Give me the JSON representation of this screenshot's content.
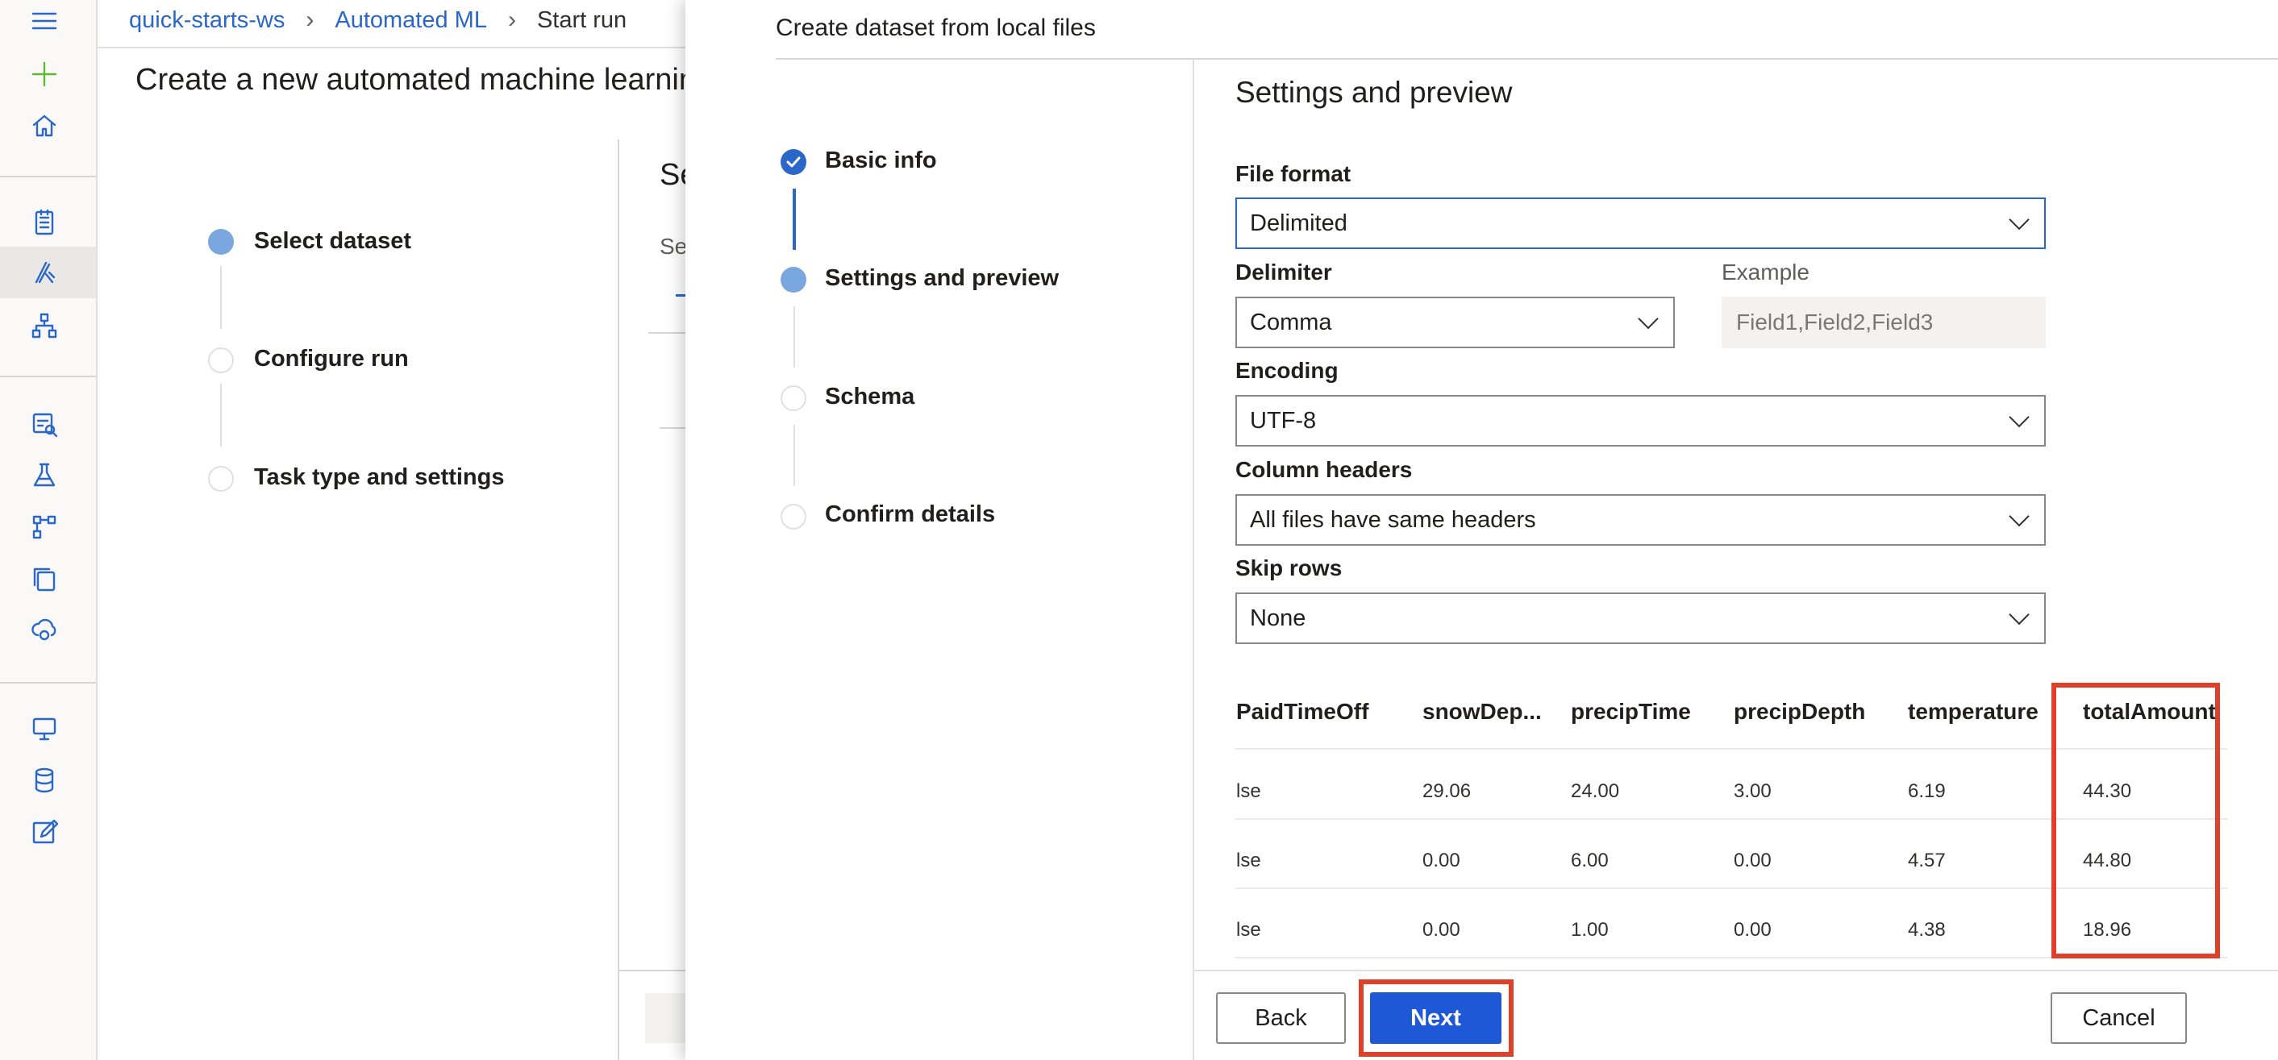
{
  "breadcrumb": {
    "workspace": "quick-starts-ws",
    "section": "Automated ML",
    "current": "Start run"
  },
  "background": {
    "page_title": "Create a new automated machine learning",
    "steps": [
      "Select dataset",
      "Configure run",
      "Task type and settings"
    ],
    "stub_title": "Se",
    "stub_sub": "Se"
  },
  "panel": {
    "title": "Create dataset from local files",
    "wizard_steps": [
      "Basic info",
      "Settings and preview",
      "Schema",
      "Confirm details"
    ],
    "section_title": "Settings and preview",
    "fields": {
      "file_format": {
        "label": "File format",
        "value": "Delimited"
      },
      "delimiter": {
        "label": "Delimiter",
        "value": "Comma"
      },
      "example": {
        "label": "Example",
        "value": "Field1,Field2,Field3"
      },
      "encoding": {
        "label": "Encoding",
        "value": "UTF-8"
      },
      "column_headers": {
        "label": "Column headers",
        "value": "All files have same headers"
      },
      "skip_rows": {
        "label": "Skip rows",
        "value": "None"
      }
    },
    "preview_table": {
      "columns": [
        "PaidTimeOff",
        "snowDep...",
        "precipTime",
        "precipDepth",
        "temperature",
        "totalAmount"
      ],
      "rows": [
        [
          "lse",
          "29.06",
          "24.00",
          "3.00",
          "6.19",
          "44.30"
        ],
        [
          "lse",
          "0.00",
          "6.00",
          "0.00",
          "4.57",
          "44.80"
        ],
        [
          "lse",
          "0.00",
          "1.00",
          "0.00",
          "4.38",
          "18.96"
        ]
      ]
    },
    "buttons": {
      "back": "Back",
      "next": "Next",
      "cancel": "Cancel"
    }
  },
  "colors": {
    "accent": "#2b67c9",
    "primary_button": "#1f58d6",
    "highlight": "#e0402a",
    "add_icon": "#5fb832"
  },
  "icons": [
    "hamburger-icon",
    "add-icon",
    "home-icon",
    "notebooks-icon",
    "automated-ml-icon",
    "designer-icon",
    "datasets-icon",
    "experiments-icon",
    "pipelines-icon",
    "models-icon",
    "endpoints-icon",
    "compute-icon",
    "datastores-icon",
    "data-labeling-icon"
  ]
}
